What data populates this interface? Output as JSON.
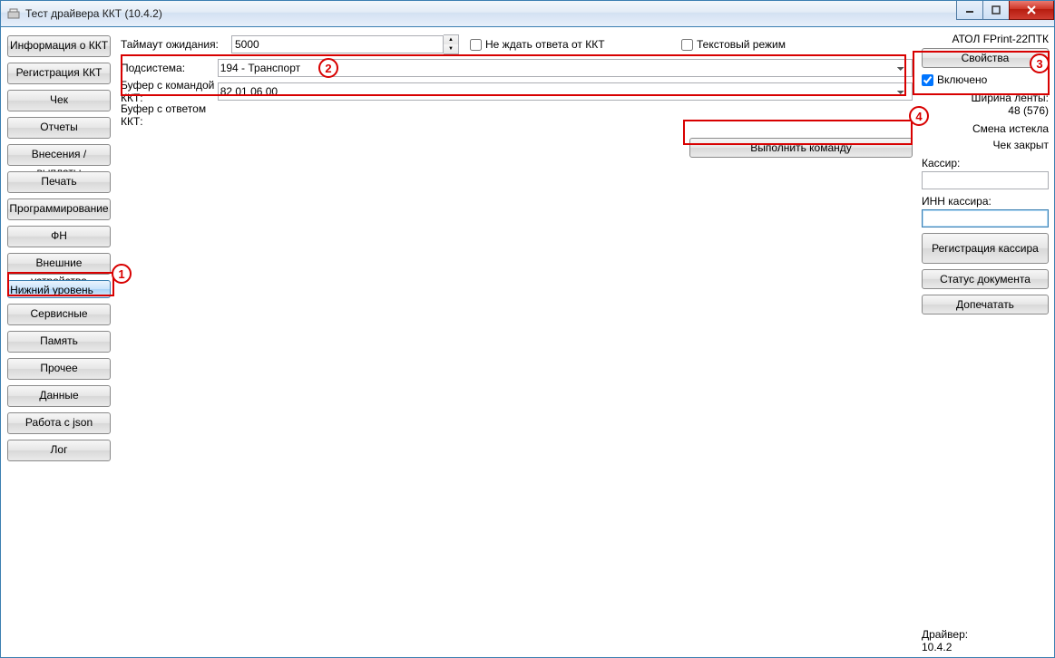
{
  "title": "Тест драйвера ККТ (10.4.2)",
  "sidebar": {
    "items": [
      "Информация о ККТ",
      "Регистрация ККТ",
      "Чек",
      "Отчеты",
      "Внесения / выплаты",
      "Печать",
      "Программирование",
      "ФН",
      "Внешние устройства",
      "Нижний уровень",
      "Сервисные",
      "Память",
      "Прочее",
      "Данные",
      "Работа с json",
      "Лог"
    ],
    "selected": 9
  },
  "main": {
    "timeout_label": "Таймаут ожидания:",
    "timeout_value": "5000",
    "nowait_label": "Не ждать ответа от ККТ",
    "nowait_checked": false,
    "textmode_label": "Текстовый режим",
    "textmode_checked": false,
    "subsystem_label": "Подсистема:",
    "subsystem_value": "194 - Транспорт",
    "cmdbuf_label": "Буфер с командой ККТ:",
    "cmdbuf_value": "82 01 06 00",
    "respbuf_label": "Буфер с ответом ККТ:",
    "respbuf_value": "",
    "exec_label": "Выполнить команду"
  },
  "right": {
    "device_name": "АТОЛ FPrint-22ПТК",
    "props_btn": "Свойства",
    "enabled_label": "Включено",
    "enabled_checked": true,
    "tape_label": "Ширина ленты:",
    "tape_value": "48 (576)",
    "shift_state": "Смена истекла",
    "cheque_state": "Чек закрыт",
    "cashier_label": "Кассир:",
    "cashier_value": "",
    "cashier_inn_label": "ИНН кассира:",
    "cashier_inn_value": "",
    "reg_cashier_btn": "Регистрация кассира",
    "doc_status_btn": "Статус документа",
    "reprint_btn": "Допечатать",
    "driver_label": "Драйвер:",
    "driver_version": "10.4.2"
  },
  "callouts": {
    "c1": "1",
    "c2": "2",
    "c3": "3",
    "c4": "4"
  }
}
